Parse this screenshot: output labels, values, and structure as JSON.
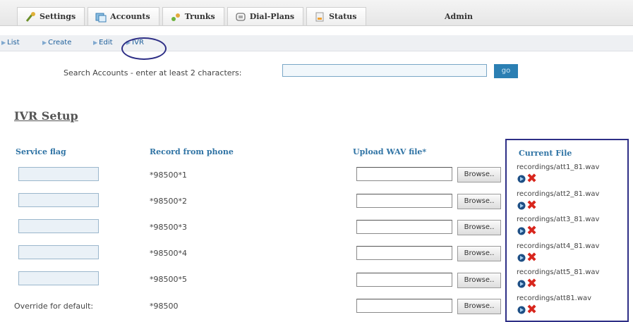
{
  "tabs": [
    {
      "label": "Settings",
      "icon": "settings-icon"
    },
    {
      "label": "Accounts",
      "icon": "accounts-icon"
    },
    {
      "label": "Trunks",
      "icon": "trunks-icon"
    },
    {
      "label": "Dial-Plans",
      "icon": "dialplans-icon"
    },
    {
      "label": "Status",
      "icon": "status-icon"
    }
  ],
  "admin_label": "Admin",
  "subnav": [
    "List",
    "Create",
    "Edit",
    "IVR"
  ],
  "search": {
    "label": "Search Accounts - enter at least 2 characters:",
    "value": "",
    "go_label": "go"
  },
  "page_title": "IVR Setup",
  "columns": {
    "service_flag": "Service flag",
    "record": "Record from phone",
    "upload": "Upload WAV file*",
    "current": "Current File"
  },
  "rows": [
    {
      "flag": "",
      "code": "*98500*1",
      "browse": "Browse..",
      "file": "recordings/att1_81.wav"
    },
    {
      "flag": "",
      "code": "*98500*2",
      "browse": "Browse..",
      "file": "recordings/att2_81.wav"
    },
    {
      "flag": "",
      "code": "*98500*3",
      "browse": "Browse..",
      "file": "recordings/att3_81.wav"
    },
    {
      "flag": "",
      "code": "*98500*4",
      "browse": "Browse..",
      "file": "recordings/att4_81.wav"
    },
    {
      "flag": "",
      "code": "*98500*5",
      "browse": "Browse..",
      "file": "recordings/att5_81.wav"
    }
  ],
  "override_row": {
    "label": "Override for default:",
    "code": "*98500",
    "browse": "Browse..",
    "file": "recordings/att81.wav"
  },
  "colors": {
    "accent": "#2f73a4",
    "highlight": "#2e2f86",
    "delete": "#d8261d"
  }
}
